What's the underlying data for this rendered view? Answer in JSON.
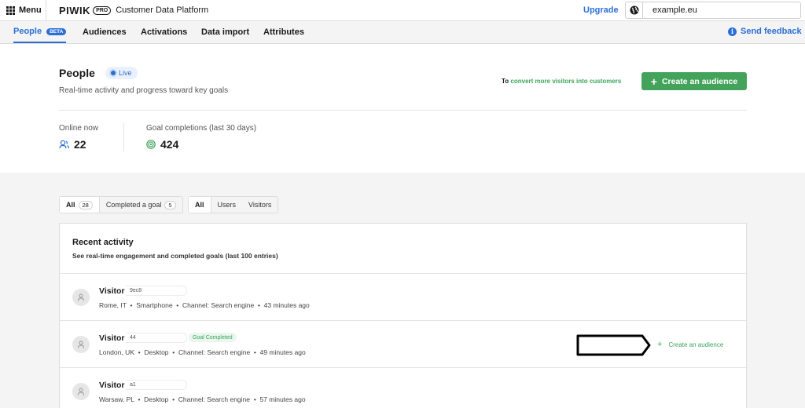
{
  "topbar": {
    "menu_label": "Menu",
    "logo_main": "PIWIK",
    "logo_pro": "PRO",
    "product_name": "Customer Data Platform",
    "upgrade_label": "Upgrade",
    "site_name": "example.eu"
  },
  "nav": {
    "tabs": [
      {
        "label": "People",
        "badge": "BETA",
        "active": true
      },
      {
        "label": "Audiences"
      },
      {
        "label": "Activations"
      },
      {
        "label": "Data import"
      },
      {
        "label": "Attributes"
      }
    ],
    "feedback_label": "Send feedback"
  },
  "header": {
    "title": "People",
    "status": "Live",
    "subtitle": "Real-time activity and progress toward key goals",
    "promo_prefix": "To",
    "promo_link": "convert more visitors into customers",
    "create_button": "Create an audience",
    "stats": [
      {
        "label": "Online now",
        "value": "22",
        "icon": "users-icon"
      },
      {
        "label": "Goal completions (last 30 days)",
        "value": "424",
        "icon": "target-icon"
      }
    ]
  },
  "filters": {
    "scope": [
      {
        "label": "All",
        "count": "28",
        "active": true
      },
      {
        "label": "Completed a goal",
        "count": "5"
      }
    ],
    "type": [
      {
        "label": "All",
        "active": true
      },
      {
        "label": "Users"
      },
      {
        "label": "Visitors"
      }
    ]
  },
  "activity": {
    "title": "Recent activity",
    "subtitle": "See real-time engagement and completed goals (last 100 entries)",
    "rows": [
      {
        "name": "Visitor",
        "id": "9ec8",
        "location": "Rome, IT",
        "device": "Smartphone",
        "channel": "Channel: Search engine",
        "time": "43 minutes ago"
      },
      {
        "name": "Visitor",
        "id": "44",
        "badge": "Goal Completed",
        "location": "London, UK",
        "device": "Desktop",
        "channel": "Channel: Search engine",
        "time": "49 minutes ago",
        "action": "Create an audience"
      },
      {
        "name": "Visitor",
        "id": "a1",
        "location": "Warsaw, PL",
        "device": "Desktop",
        "channel": "Channel: Search engine",
        "time": "57 minutes ago"
      }
    ]
  },
  "colors": {
    "accent": "#2b6fd6",
    "success": "#43a35a",
    "background": "#f4f4f4"
  }
}
